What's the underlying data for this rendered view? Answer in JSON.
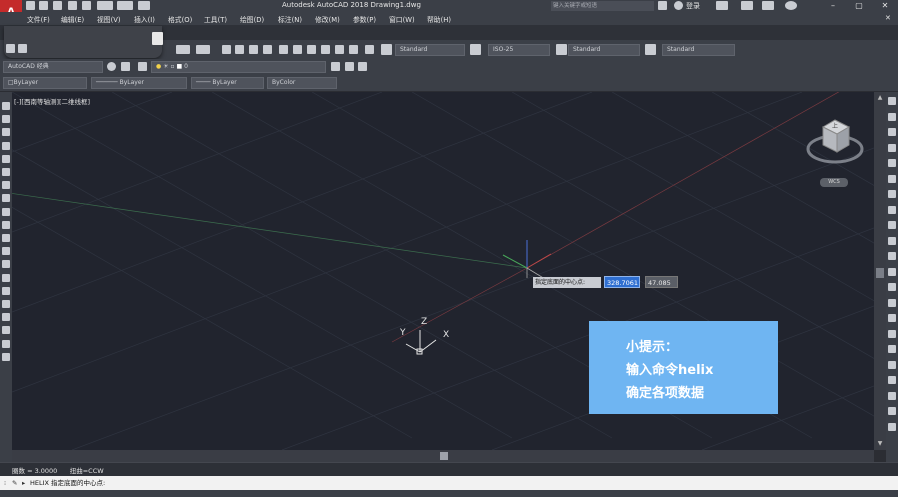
{
  "app": {
    "logo": "A",
    "window_title": "Autodesk AutoCAD 2018   Drawing1.dwg",
    "search_placeholder": "键入关键字或短语",
    "login_label": "登录"
  },
  "menu": [
    "文件(F)",
    "编辑(E)",
    "视图(V)",
    "插入(I)",
    "格式(O)",
    "工具(T)",
    "绘图(D)",
    "标注(N)",
    "修改(M)",
    "参数(P)",
    "窗口(W)",
    "帮助(H)"
  ],
  "tabs": {
    "start_tab": "开始"
  },
  "toolbar": {
    "text_style": "Standard",
    "dim_style": "ISO-25",
    "table_style": "Standard",
    "mleader_style": "Standard",
    "workspace": "AutoCAD 经典",
    "layer_value": "0",
    "color": "ByLayer",
    "linetype": "ByLayer",
    "lineweight": "ByLayer",
    "plotstyle": "ByColor"
  },
  "canvas": {
    "view_label": "[-][西南等轴测][二维线框]",
    "ucs_x": "X",
    "ucs_y": "Y",
    "ucs_z": "Z",
    "tooltip_label": "指定底面的中心点:",
    "input_x": "328.7061",
    "input_y": "47.085",
    "viewcube_face": "上",
    "wcs_label": "WCS"
  },
  "hint": {
    "title": "小提示：",
    "line1": "输入命令helix",
    "line2": "确定各项数据"
  },
  "command": {
    "history_text": "圈数 = 3.0000      扭曲=CCW",
    "prompt": "HELIX 指定底面的中心点:"
  },
  "icons": [
    "new-icon",
    "open-icon",
    "save-icon",
    "print-icon",
    "undo-icon",
    "redo-icon",
    "pan-icon",
    "zoom-icon",
    "properties-icon",
    "text-style-icon",
    "dim-style-icon",
    "table-style-icon",
    "mleader-style-icon",
    "gear-icon",
    "layer-icon",
    "line-icon",
    "circle-icon",
    "arc-icon",
    "rectangle-icon",
    "hatch-icon",
    "erase-icon",
    "copy-icon",
    "mirror-icon",
    "offset-icon",
    "move-icon",
    "rotate-icon",
    "scale-icon",
    "trim-icon",
    "fillet-icon",
    "explode-icon"
  ]
}
